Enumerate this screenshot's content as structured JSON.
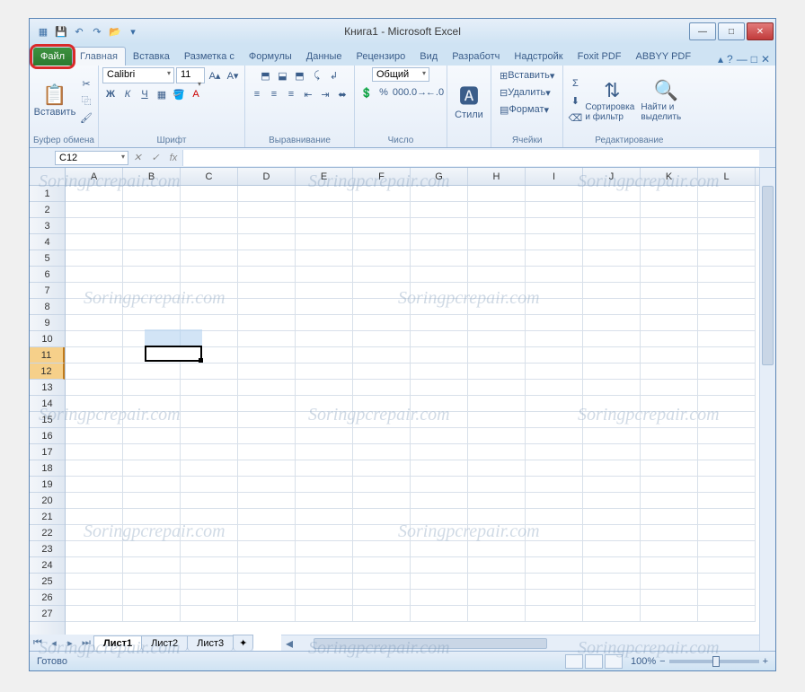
{
  "title": "Книга1 - Microsoft Excel",
  "qat": {
    "save": "💾",
    "undo": "↶",
    "redo": "↷",
    "open": "📂"
  },
  "tabs": {
    "file": "Файл",
    "list": [
      "Главная",
      "Вставка",
      "Разметка с",
      "Формулы",
      "Данные",
      "Рецензиро",
      "Вид",
      "Разработч",
      "Надстройк",
      "Foxit PDF",
      "ABBYY PDF"
    ],
    "active_index": 0
  },
  "ribbon": {
    "clipboard": {
      "paste": "Вставить",
      "label": "Буфер обмена"
    },
    "font": {
      "name": "Calibri",
      "size": "11",
      "label": "Шрифт",
      "bold": "Ж",
      "italic": "К",
      "underline": "Ч"
    },
    "align": {
      "label": "Выравнивание"
    },
    "number": {
      "format": "Общий",
      "label": "Число"
    },
    "styles": {
      "btn": "Стили",
      "label": ""
    },
    "cells": {
      "insert": "Вставить",
      "delete": "Удалить",
      "format": "Формат",
      "label": "Ячейки"
    },
    "editing": {
      "sort": "Сортировка и фильтр",
      "find": "Найти и выделить",
      "label": "Редактирование"
    }
  },
  "name_box": "C12",
  "fx": "fx",
  "columns": [
    "A",
    "B",
    "C",
    "D",
    "E",
    "F",
    "G",
    "H",
    "I",
    "J",
    "K",
    "L"
  ],
  "rows": [
    "1",
    "2",
    "3",
    "4",
    "5",
    "6",
    "7",
    "8",
    "9",
    "10",
    "11",
    "12",
    "13",
    "14",
    "15",
    "16",
    "17",
    "18",
    "19",
    "20",
    "21",
    "22",
    "23",
    "24",
    "25",
    "26",
    "27"
  ],
  "selected_rows": [
    10,
    11
  ],
  "sheets": {
    "list": [
      "Лист1",
      "Лист2",
      "Лист3"
    ],
    "active": 0
  },
  "status": {
    "ready": "Готово",
    "zoom": "100%",
    "minus": "−",
    "plus": "+"
  },
  "watermark": "Soringpcrepair.com",
  "help": {
    "q": "?",
    "up": "▴"
  }
}
